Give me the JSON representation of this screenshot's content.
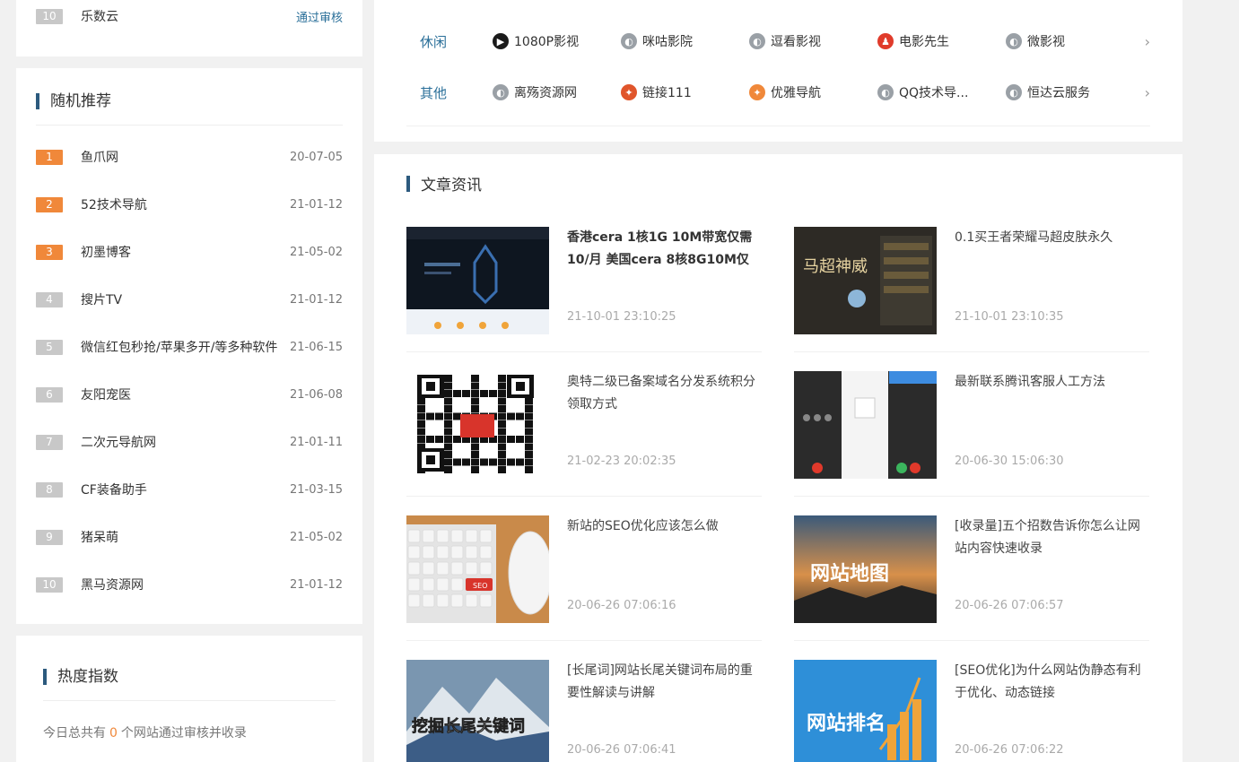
{
  "top_row": {
    "rank": "10",
    "name": "乐数云",
    "status": "通过审核"
  },
  "random": {
    "title": "随机推荐",
    "items": [
      {
        "rank": "1",
        "name": "鱼爪网",
        "date": "20-07-05",
        "hot": true
      },
      {
        "rank": "2",
        "name": "52技术导航",
        "date": "21-01-12",
        "hot": true
      },
      {
        "rank": "3",
        "name": "初墨博客",
        "date": "21-05-02",
        "hot": true
      },
      {
        "rank": "4",
        "name": "搜片TV",
        "date": "21-01-12",
        "hot": false
      },
      {
        "rank": "5",
        "name": "微信红包秒抢/苹果多开/等多种软件",
        "date": "21-06-15",
        "hot": false
      },
      {
        "rank": "6",
        "name": "友阳宠医",
        "date": "21-06-08",
        "hot": false
      },
      {
        "rank": "7",
        "name": "二次元导航网",
        "date": "21-01-11",
        "hot": false
      },
      {
        "rank": "8",
        "name": "CF装备助手",
        "date": "21-03-15",
        "hot": false
      },
      {
        "rank": "9",
        "name": "猪呆萌",
        "date": "21-05-02",
        "hot": false
      },
      {
        "rank": "10",
        "name": "黑马资源网",
        "date": "21-01-12",
        "hot": false
      }
    ]
  },
  "heat": {
    "title": "热度指数",
    "prefix": "今日总共有",
    "count": "0",
    "suffix": "个网站通过审核并收录"
  },
  "sites": [
    {
      "category": "休闲",
      "items": [
        {
          "name": "1080P影视",
          "icon": "film-icon",
          "color": "#1a1a1a"
        },
        {
          "name": "咪咕影院",
          "icon": "globe-icon",
          "color": "#9aa0a6"
        },
        {
          "name": "逗看影视",
          "icon": "globe-icon",
          "color": "#9aa0a6"
        },
        {
          "name": "电影先生",
          "icon": "person-icon",
          "color": "#e03b2b"
        },
        {
          "name": "微影视",
          "icon": "globe-icon",
          "color": "#9aa0a6"
        }
      ]
    },
    {
      "category": "其他",
      "items": [
        {
          "name": "离殇资源网",
          "icon": "globe-icon",
          "color": "#9aa0a6"
        },
        {
          "name": "链接111",
          "icon": "brand-icon",
          "color": "#e0552b"
        },
        {
          "name": "优雅导航",
          "icon": "brand-icon",
          "color": "#f0883a"
        },
        {
          "name": "QQ技术导...",
          "icon": "globe-icon",
          "color": "#9aa0a6"
        },
        {
          "name": "恒达云服务",
          "icon": "globe-icon",
          "color": "#9aa0a6"
        }
      ]
    }
  ],
  "news": {
    "title": "文章资讯",
    "items": [
      {
        "headline": "香港cera 1核1G 10M带宽仅需10/月 美国cera 8核8G10M仅",
        "time": "21-10-01 23:10:25",
        "bold": true,
        "thumb": "website-screenshot"
      },
      {
        "headline": "0.1买王者荣耀马超皮肤永久",
        "time": "21-10-01 23:10:35",
        "bold": false,
        "thumb": "game-poster"
      },
      {
        "headline": "奥特二级已备案域名分发系统积分领取方式",
        "time": "21-02-23 20:02:35",
        "bold": false,
        "thumb": "qr-code"
      },
      {
        "headline": "最新联系腾讯客服人工方法",
        "time": "20-06-30 15:06:30",
        "bold": false,
        "thumb": "phone-screens"
      },
      {
        "headline": "新站的SEO优化应该怎么做",
        "time": "20-06-26 07:06:16",
        "bold": false,
        "thumb": "keyboard-mouse"
      },
      {
        "headline": "[收录量]五个招数告诉你怎么让网站内容快速收录",
        "time": "20-06-26 07:06:57",
        "bold": false,
        "thumb": "sunset-map"
      },
      {
        "headline": "[长尾词]网站长尾关键词布局的重要性解读与讲解",
        "time": "20-06-26 07:06:41",
        "bold": false,
        "thumb": "mountain"
      },
      {
        "headline": "[SEO优化]为什么网站伪静态有利于优化、动态链接",
        "time": "20-06-26 07:06:22",
        "bold": false,
        "thumb": "ranking-chart"
      }
    ],
    "thumb_text": {
      "sunset": "网站地图",
      "mountain": "挖掘长尾关键词",
      "ranking": "网站排名",
      "game": "马超神威",
      "seo_key": "SEO"
    }
  }
}
